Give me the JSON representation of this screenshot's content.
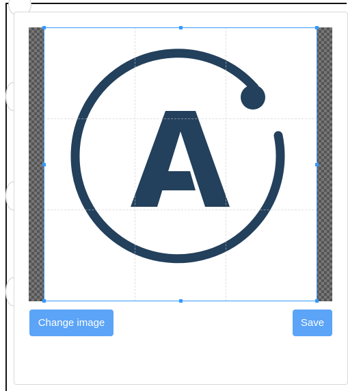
{
  "modal": {
    "change_image_label": "Change image",
    "save_label": "Save"
  },
  "logo": {
    "letter": "A",
    "color": "#23405c"
  },
  "colors": {
    "accent": "#5ba4f7",
    "crop_border": "#3399ff"
  }
}
